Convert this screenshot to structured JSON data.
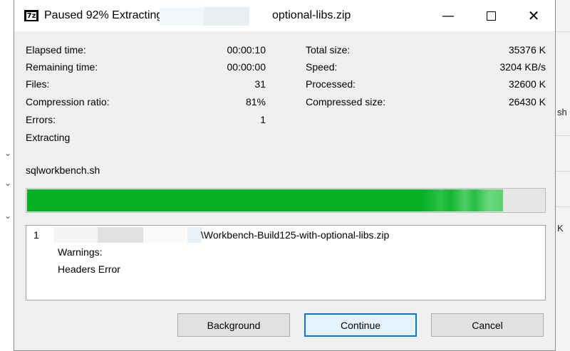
{
  "window": {
    "title_status": "Paused 92% Extracting",
    "title_file": "optional-libs.zip",
    "app_icon_text": "7z",
    "controls": {
      "minimize": "—",
      "maximize": "",
      "close": "✕"
    }
  },
  "stats_left": [
    {
      "label": "Elapsed time:",
      "value": "00:00:10"
    },
    {
      "label": "Remaining time:",
      "value": "00:00:00"
    },
    {
      "label": "Files:",
      "value": "31"
    },
    {
      "label": "Compression ratio:",
      "value": "81%"
    },
    {
      "label": "Errors:",
      "value": "1"
    }
  ],
  "stats_right": [
    {
      "label": "Total size:",
      "value": "35376 K"
    },
    {
      "label": "Speed:",
      "value": "3204 KB/s"
    },
    {
      "label": "Processed:",
      "value": "32600 K"
    },
    {
      "label": "Compressed size:",
      "value": "26430 K"
    }
  ],
  "operation": "Extracting",
  "current_file": "sqlworkbench.sh",
  "progress": {
    "percent": 92,
    "color": "#06b025"
  },
  "messages": {
    "index": "1",
    "path": "\\Workbench-Build125-with-optional-libs.zip",
    "warning_label": "Warnings:",
    "error_text": "Headers Error"
  },
  "buttons": {
    "background": "Background",
    "continue": "Continue",
    "cancel": "Cancel"
  },
  "background_window": {
    "partial_text_1": "sh",
    "partial_text_2": "K"
  }
}
